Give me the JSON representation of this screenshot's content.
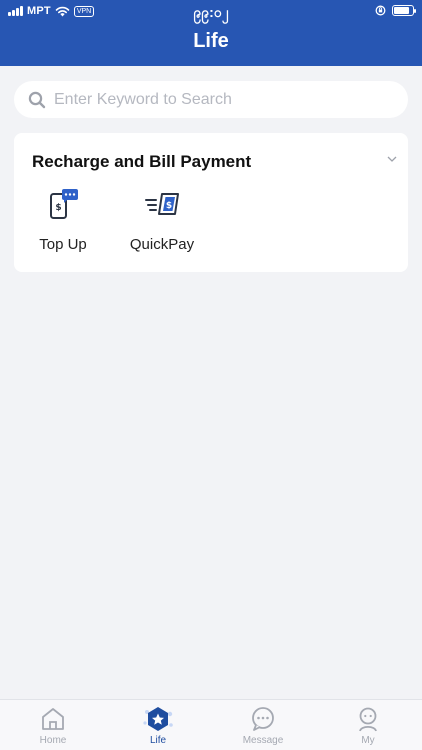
{
  "status_bar": {
    "carrier": "MPT",
    "vpn": "VPN",
    "time": "၉၉:၀၂",
    "battery_level": 0.85
  },
  "header": {
    "title": "Life"
  },
  "search": {
    "placeholder": "Enter Keyword to Search"
  },
  "section": {
    "title": "Recharge and Bill Payment",
    "items": [
      {
        "label": "Top Up",
        "icon": "top-up-icon"
      },
      {
        "label": "QuickPay",
        "icon": "quickpay-icon"
      }
    ]
  },
  "tabbar": {
    "active": "Life",
    "tabs": [
      {
        "label": "Home",
        "icon": "home-icon"
      },
      {
        "label": "Life",
        "icon": "life-icon"
      },
      {
        "label": "Message",
        "icon": "message-icon"
      },
      {
        "label": "My",
        "icon": "person-icon"
      }
    ]
  },
  "colors": {
    "brand": "#2756b3",
    "active_tab": "#1f4d9f",
    "inactive_tab": "#a5a9b2",
    "background": "#f2f3f6"
  }
}
